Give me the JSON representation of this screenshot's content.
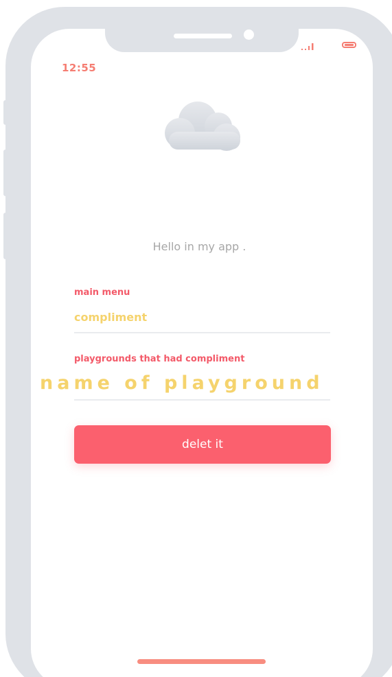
{
  "status_bar": {
    "time": "12:55",
    "signal_icon": "signal-bars-icon",
    "battery_icon": "battery-icon"
  },
  "header": {
    "logo_icon": "cloud-icon",
    "greeting": "Hello in my app   ."
  },
  "form": {
    "main_menu_label": "main menu",
    "main_menu_value": "compliment",
    "playgrounds_label": "playgrounds that had compliment",
    "playground_value": "name of playground"
  },
  "actions": {
    "delete_label": "delet it"
  },
  "colors": {
    "frame": "#dfe2e7",
    "accent_red": "#fb606e",
    "label_red": "#f35a69",
    "value_yellow": "#f5d36d",
    "status_coral": "#f57d72",
    "greeting_gray": "#a7a7a7"
  }
}
